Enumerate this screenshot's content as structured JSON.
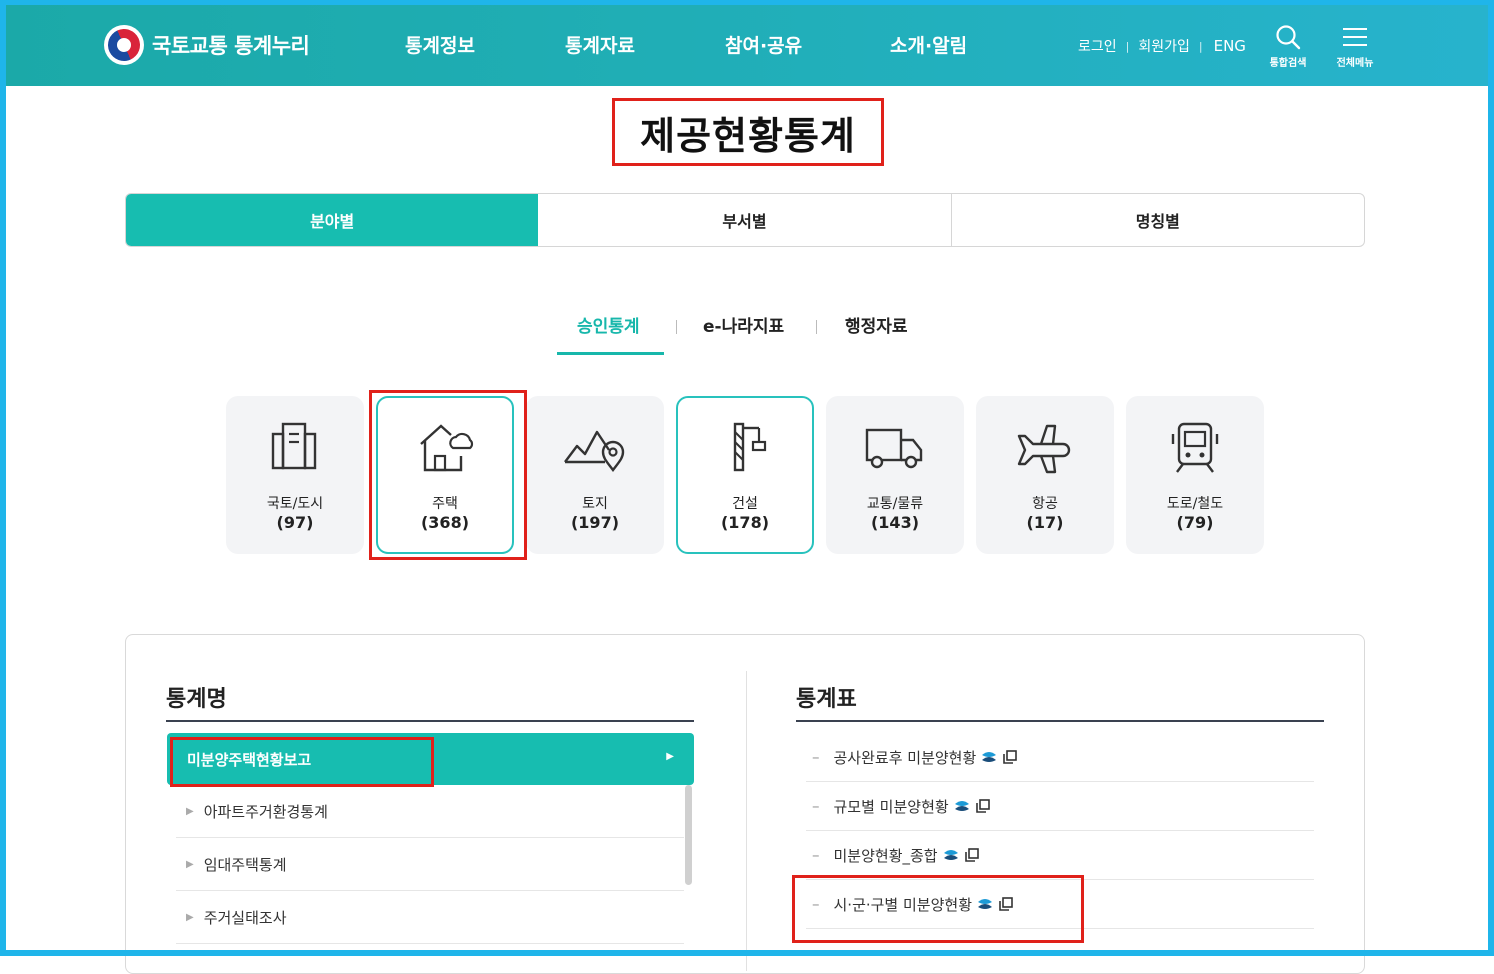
{
  "header": {
    "logo_text": "국토교통 통계누리",
    "nav": [
      "통계정보",
      "통계자료",
      "참여·공유",
      "소개·알림"
    ],
    "util": {
      "login": "로그인",
      "join": "회원가입",
      "lang": "ENG",
      "sep": "|"
    },
    "search_label": "통합검색",
    "menu_label": "전체메뉴",
    "icons": [
      "search-icon",
      "hamburger-menu-icon"
    ]
  },
  "page_title": "제공현황통계",
  "main_tabs": [
    {
      "label": "분야별",
      "active": true
    },
    {
      "label": "부서별",
      "active": false
    },
    {
      "label": "명칭별",
      "active": false
    }
  ],
  "sub_tabs": [
    {
      "label": "승인통계",
      "active": true
    },
    {
      "label": "e-나라지표",
      "active": false
    },
    {
      "label": "행정자료",
      "active": false
    }
  ],
  "categories": [
    {
      "name": "국토/도시",
      "count": "(97)",
      "icon": "building-icon"
    },
    {
      "name": "주택",
      "count": "(368)",
      "icon": "house-icon"
    },
    {
      "name": "토지",
      "count": "(197)",
      "icon": "land-icon"
    },
    {
      "name": "건설",
      "count": "(178)",
      "icon": "crane-icon"
    },
    {
      "name": "교통/물류",
      "count": "(143)",
      "icon": "truck-icon"
    },
    {
      "name": "항공",
      "count": "(17)",
      "icon": "airplane-icon"
    },
    {
      "name": "도로/철도",
      "count": "(79)",
      "icon": "train-icon"
    }
  ],
  "stats_list": {
    "heading": "통계명",
    "active_item": "미분양주택현황보고",
    "items": [
      "아파트주거환경통계",
      "임대주택통계",
      "주거실태조사"
    ]
  },
  "tables_list": {
    "heading": "통계표",
    "items": [
      "공사완료후 미분양현황",
      "규모별 미분양현황",
      "미분양현황_종합",
      "시·군·구별 미분양현황"
    ]
  },
  "colors": {
    "accent": "#17bdb0",
    "highlight": "#e0211a",
    "frame": "#1fb5ea"
  }
}
